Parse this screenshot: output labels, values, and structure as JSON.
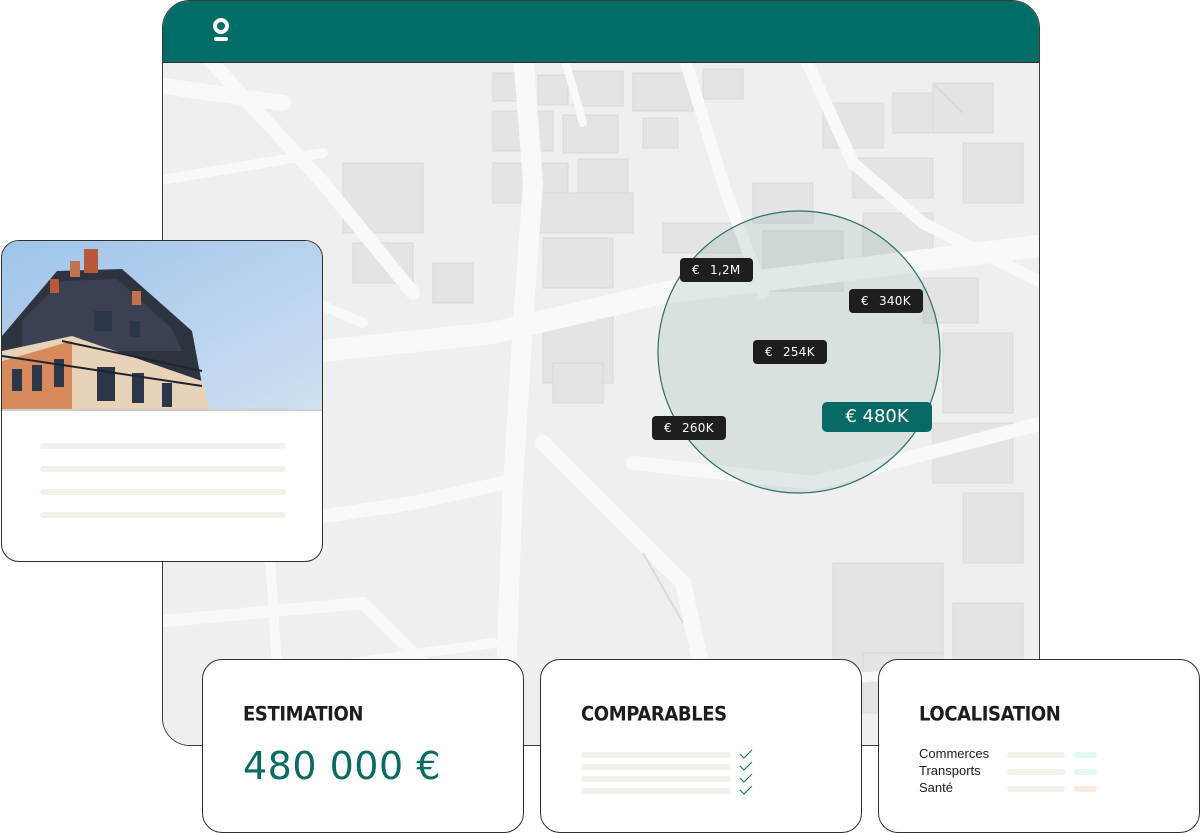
{
  "app": {
    "logo_icon": "app-logo-icon",
    "header_color": "#026d66"
  },
  "map": {
    "radius_circle_color": "#2b6f69",
    "price_markers": [
      {
        "currency": "€",
        "value": "1,2M"
      },
      {
        "currency": "€",
        "value": "340K"
      },
      {
        "currency": "€",
        "value": "254K"
      },
      {
        "currency": "€",
        "value": "260K"
      }
    ],
    "selected_marker": {
      "label": "€ 480K",
      "color": "#056a63"
    }
  },
  "property_card": {
    "photo": "building-photo",
    "placeholder_lines": 4
  },
  "cards": {
    "estimation": {
      "title": "ESTIMATION",
      "value": "480 000 €"
    },
    "comparables": {
      "title": "COMPARABLES",
      "rows": 4,
      "checked": 4
    },
    "localisation": {
      "title": "LOCALISATION",
      "items": [
        {
          "label": "Commerces",
          "accent": "#e4f7f2"
        },
        {
          "label": "Transports",
          "accent": "#e4f7f2"
        },
        {
          "label": "Santé",
          "accent": "#fde9df"
        }
      ]
    }
  }
}
